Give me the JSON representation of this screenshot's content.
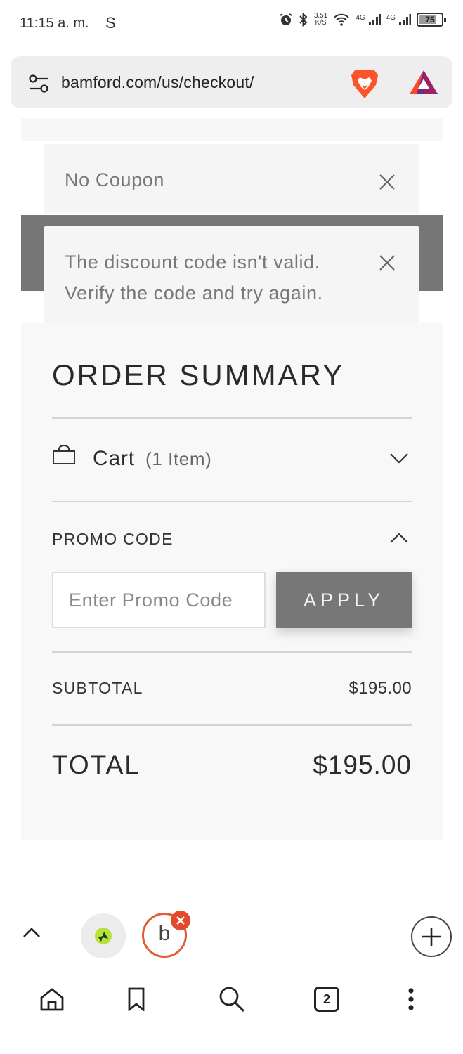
{
  "status_bar": {
    "time": "11:15 a. m.",
    "carrier_icon": "S",
    "speed_value": "3.51",
    "speed_unit": "K/S",
    "net_1": "4G",
    "net_2": "4G",
    "battery": "75"
  },
  "url_bar": {
    "url": "bamford.com/us/checkout/",
    "icons": [
      "site-settings-icon",
      "brave-lion-icon",
      "bat-rewards-icon"
    ]
  },
  "notifications": {
    "coupon": "No Coupon",
    "error_line1": "The discount code isn't valid.",
    "error_line2": "Verify the code and try again."
  },
  "order_summary": {
    "title": "ORDER SUMMARY",
    "cart_label": "Cart",
    "cart_count": "(1 Item)",
    "promo_label": "PROMO CODE",
    "promo_placeholder": "Enter Promo Code",
    "apply_label": "APPLY",
    "subtotal_label": "SUBTOTAL",
    "subtotal_value": "$195.00",
    "total_label": "TOTAL",
    "total_value": "$195.00"
  },
  "tab_strip": {
    "active_tab_letter": "b"
  },
  "bottom_nav": {
    "tabs_count": "2",
    "items": [
      "home-icon",
      "bookmark-icon",
      "search-icon",
      "tabs-icon",
      "menu-icon"
    ]
  },
  "colors": {
    "apply_button": "#777777",
    "banner": "#767676",
    "panel_background": "#f8f8f8",
    "tab_accent": "#e35b35"
  }
}
